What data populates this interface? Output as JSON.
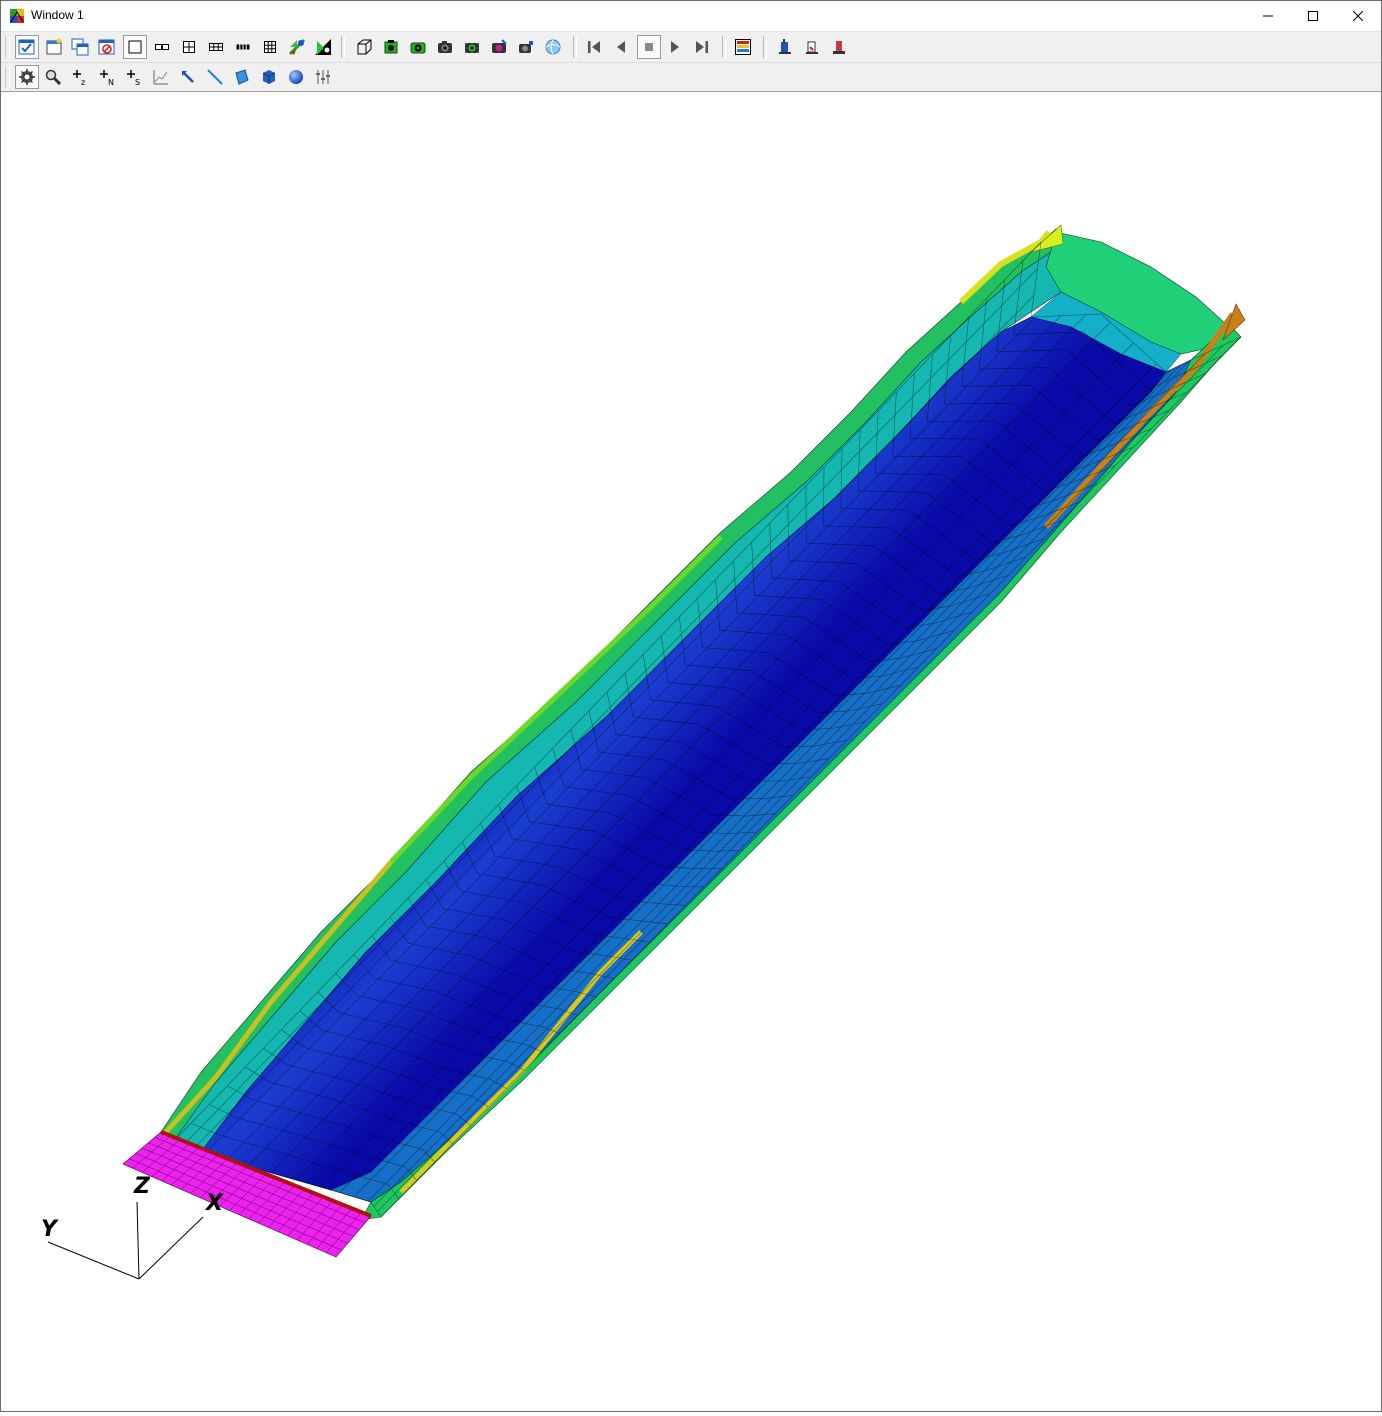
{
  "window": {
    "title": "Window 1",
    "controls": [
      "minimize",
      "maximize",
      "close"
    ]
  },
  "toolbar_top": {
    "groups": [
      [
        "frame-active-icon",
        "new-frame-icon",
        "copy-frame-icon",
        "delete-frame-icon",
        "layout-single-icon",
        "layout-1x2-icon",
        "layout-2x2-icon",
        "layout-2x3-icon",
        "layout-1x4-icon",
        "layout-3x3-icon",
        "cut-plane-icon",
        "contour-icon"
      ],
      [
        "bounding-box-icon",
        "view-front-icon",
        "view-side-icon",
        "camera-icon",
        "camera-record-icon",
        "camera-color-icon",
        "camera-small-icon",
        "sphere-view-icon"
      ],
      [
        "animation-first-icon",
        "animation-prev-icon",
        "animation-stop-icon",
        "animation-play-icon",
        "animation-last-icon"
      ],
      [
        "legend-icon"
      ],
      [
        "probe-icon",
        "probe-edit-icon",
        "probe-stack-icon"
      ]
    ]
  },
  "toolbar_bottom": {
    "items": [
      "rotate-icon",
      "zoom-icon",
      "translate-z-icon",
      "translate-n-icon",
      "translate-s-icon",
      "plot-xy-icon",
      "pick-icon",
      "line-icon",
      "surface-icon",
      "cube-icon",
      "sphere-icon",
      "sliders-icon"
    ]
  },
  "scene": {
    "axes": {
      "x_label": "X",
      "y_label": "Y",
      "z_label": "Z"
    },
    "colors": {
      "background": "#ffffff",
      "deep_blue": "#0a0aa8",
      "blue": "#1a3fd0",
      "mid_blue": "#1670c8",
      "cyan": "#12a8c8",
      "teal": "#18c8a0",
      "green": "#22d648",
      "lime": "#88e020",
      "yellow": "#d8d020",
      "orange": "#c88018",
      "red_line": "#b01010",
      "clamp_magenta": "#ee22ee"
    }
  }
}
